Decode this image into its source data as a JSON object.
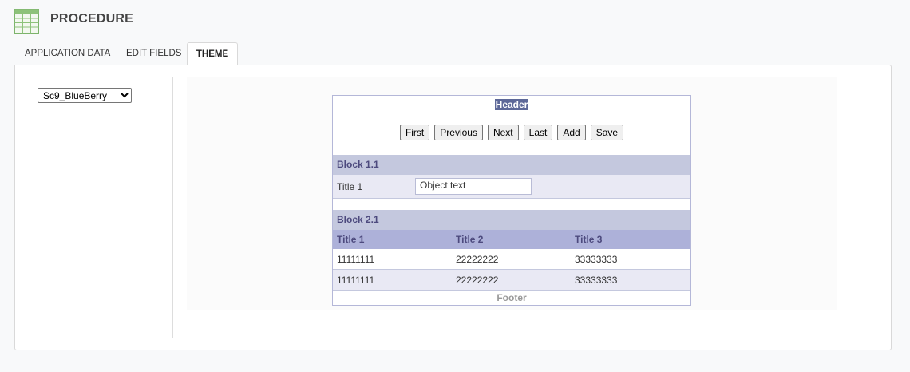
{
  "app": {
    "icon": "spreadsheet-icon",
    "title": "PROCEDURE"
  },
  "tabs": [
    {
      "label": "APPLICATION DATA",
      "active": false
    },
    {
      "label": "EDIT FIELDS",
      "active": false
    },
    {
      "label": "THEME",
      "active": true
    }
  ],
  "theme_selector": {
    "value": "Sc9_BlueBerry",
    "options": [
      "Sc9_BlueBerry"
    ]
  },
  "preview": {
    "header": "Header",
    "nav_buttons": [
      "First",
      "Previous",
      "Next",
      "Last",
      "Add",
      "Save"
    ],
    "block1": {
      "title": "Block 1.1",
      "field_label": "Title 1",
      "field_value": "Object text"
    },
    "block2": {
      "title": "Block 2.1",
      "columns": [
        "Title 1",
        "Title 2",
        "Title 3"
      ],
      "rows": [
        [
          "11111111",
          "22222222",
          "33333333"
        ],
        [
          "11111111",
          "22222222",
          "33333333"
        ]
      ]
    },
    "footer": "Footer"
  },
  "colors": {
    "header_bg": "#5d6898",
    "block_title_bg": "#c4c8de",
    "grid_header_bg": "#adb1d9",
    "row_alt_bg": "#e9e9f4",
    "accent_text": "#4d4a7e"
  }
}
